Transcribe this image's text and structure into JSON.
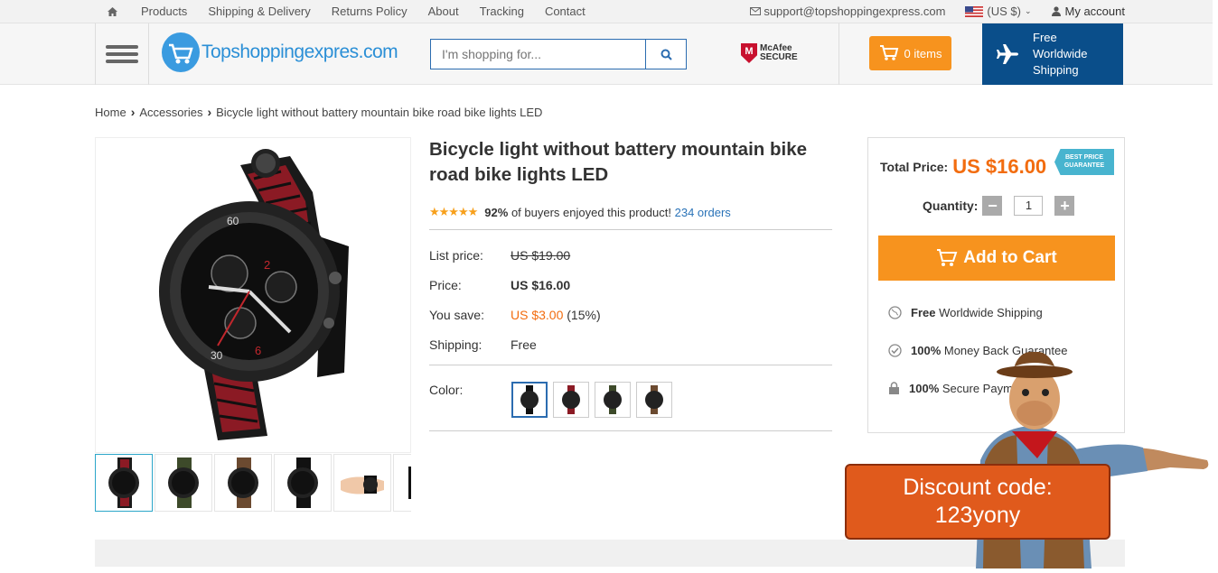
{
  "topbar": {
    "nav": [
      "Products",
      "Shipping & Delivery",
      "Returns Policy",
      "About",
      "Tracking",
      "Contact"
    ],
    "email": "support@topshoppingexpress.com",
    "currency": "(US $)",
    "account": "My account"
  },
  "header": {
    "logo_text": "Topshoppingexpres.com",
    "search_placeholder": "I'm shopping for...",
    "mcafee_line1": "McAfee",
    "mcafee_line2": "SECURE",
    "cart_label": "0 items",
    "free_shipping": "Free Worldwide Shipping"
  },
  "breadcrumb": {
    "home": "Home",
    "category": "Accessories",
    "current": "Bicycle light without battery mountain bike road bike lights LED"
  },
  "product": {
    "title": "Bicycle light without battery mountain bike road bike lights LED",
    "rating_percent": "92%",
    "rating_text": "of buyers enjoyed this product!",
    "orders": "234 orders",
    "list_price_label": "List price:",
    "list_price": "US $19.00",
    "price_label": "Price:",
    "price": "US $16.00",
    "save_label": "You save:",
    "save_amount": "US $3.00",
    "save_percent": "(15%)",
    "shipping_label": "Shipping:",
    "shipping": "Free",
    "color_label": "Color:"
  },
  "buybox": {
    "total_label": "Total Price:",
    "total": "US $16.00",
    "badge_line1": "BEST PRICE",
    "badge_line2": "GUARANTEE",
    "quantity_label": "Quantity:",
    "quantity": "1",
    "minus": "−",
    "plus": "+",
    "add_to_cart": "Add to Cart",
    "features": [
      {
        "bold": "Free",
        "text": "Worldwide Shipping"
      },
      {
        "bold": "100%",
        "text": "Money Back Guarantee"
      },
      {
        "bold": "100%",
        "text": "Secure Payment"
      }
    ]
  },
  "promo": {
    "discount_line1": "Discount code:",
    "discount_line2": "123yony"
  },
  "colors": {
    "accent_orange": "#f7931e",
    "price_orange": "#f26c0f",
    "navy": "#0a4e8a",
    "link_blue": "#2a73b8"
  }
}
